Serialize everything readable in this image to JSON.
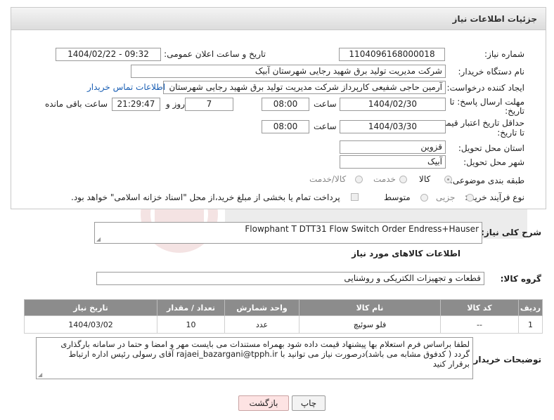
{
  "header": {
    "title": "جزئیات اطلاعات نیاز"
  },
  "form": {
    "need_number": {
      "label": "شماره نیاز:",
      "value": "1104096168000018"
    },
    "announce": {
      "label": "تاریخ و ساعت اعلان عمومی:",
      "value": "1404/02/22 - 09:32"
    },
    "buyer": {
      "label": "نام دستگاه خریدار:",
      "value": "شرکت مدیریت تولید برق شهید رجایی شهرستان آبیک"
    },
    "requester": {
      "label": "ایجاد کننده درخواست:",
      "value": "آرمین حاجی شفیعی کارپرداز شرکت مدیریت تولید برق شهید رجایی شهرستان",
      "contact_link": "اطلاعات تماس خریدار"
    },
    "deadline": {
      "label_line1": "مهلت ارسال پاسخ: تا",
      "label_line2": "تاریخ:",
      "date": "1404/02/30",
      "time_label": "ساعت",
      "time": "08:00",
      "days": "7",
      "days_label": "روز و",
      "remaining": "21:29:47",
      "remaining_label": "ساعت باقی مانده"
    },
    "price_validity": {
      "label_line1": "حداقل تاریخ اعتبار قیمت:",
      "label_line2": "تا تاریخ:",
      "date": "1404/03/30",
      "time_label": "ساعت",
      "time": "08:00"
    },
    "province": {
      "label": "استان محل تحویل:",
      "value": "قزوین"
    },
    "city": {
      "label": "شهر محل تحویل:",
      "value": "آبیک"
    },
    "category": {
      "label": "طبقه بندی موضوعی:",
      "options": [
        "کالا",
        "خدمت",
        "کالا/خدمت"
      ],
      "selected": "کالا"
    },
    "process": {
      "label": "نوع فرآیند خرید :",
      "options": [
        "جزیی",
        "متوسط"
      ],
      "payment_note": "پرداخت تمام یا بخشی از مبلغ خرید،از محل \"اسناد خزانه اسلامی\" خواهد بود."
    }
  },
  "description": {
    "label": "شرح کلی نیاز:",
    "value": "Flowphant T DTT31 Flow Switch Order Endress+Hauser"
  },
  "goods_section": {
    "title": "اطلاعات کالاهای مورد نیاز",
    "group_label": "گروه کالا:",
    "group_value": "قطعات و تجهیزات الکتریکی و روشنایی"
  },
  "table": {
    "headers": [
      "ردیف",
      "کد کالا",
      "نام کالا",
      "واحد شمارش",
      "تعداد / مقدار",
      "تاریخ نیاز"
    ],
    "rows": [
      [
        "1",
        "--",
        "فلو سوئیچ",
        "عدد",
        "10",
        "1404/03/02"
      ]
    ]
  },
  "buyer_notes": {
    "label": "توضیحات خریدار:",
    "value": "لطفا براساس فرم استعلام بها پیشنهاد قیمت داده شود بهمراه مستندات می بایست مهر و امضا و حتما در سامانه بارگذاری گردد ( کدفوق مشابه می باشد)درصورت نیاز می توانید با rajaei_bazargani@tpph.ir آقای رسولی رئیس  اداره ارتباط برقرار کنید"
  },
  "buttons": {
    "print": "چاپ",
    "back": "بازگشت"
  },
  "colors": {
    "back_button_bg": "#fde3e3",
    "link": "#1a5fb4",
    "table_header_bg": "#8c8c8c"
  }
}
